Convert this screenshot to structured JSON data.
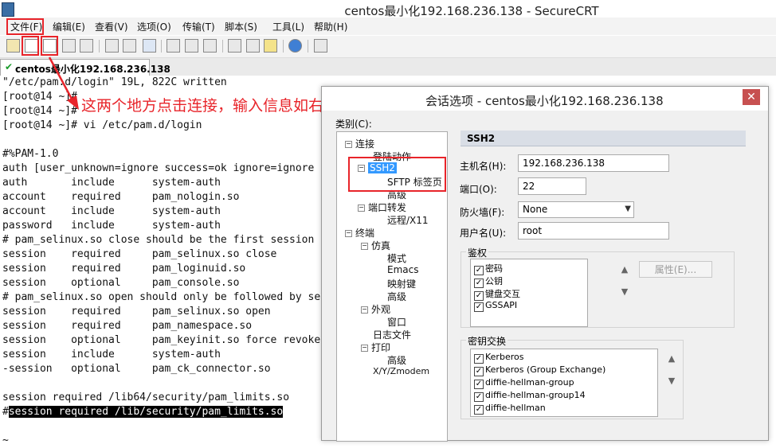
{
  "window": {
    "title": "centos最小化192.168.236.138 - SecureCRT"
  },
  "menu": [
    "文件(F)",
    "编辑(E)",
    "查看(V)",
    "选项(O)",
    "传输(T)",
    "脚本(S)",
    "工具(L)",
    "帮助(H)"
  ],
  "tab": {
    "label": "centos最小化192.168.236.138"
  },
  "terminal": {
    "lines": [
      "\"/etc/pam.d/login\" 19L, 822C written",
      "[root@14 ~]#",
      "[root@14 ~]#",
      "[root@14 ~]# vi /etc/pam.d/login",
      "",
      "#%PAM-1.0",
      "auth [user_unknown=ignore success=ok ignore=ignore",
      "auth       include      system-auth",
      "account    required     pam_nologin.so",
      "account    include      system-auth",
      "password   include      system-auth",
      "# pam_selinux.so close should be the first session",
      "session    required     pam_selinux.so close",
      "session    required     pam_loginuid.so",
      "session    optional     pam_console.so",
      "# pam_selinux.so open should only be followed by se",
      "session    required     pam_selinux.so open",
      "session    required     pam_namespace.so",
      "session    optional     pam_keyinit.so force revoke",
      "session    include      system-auth",
      "-session   optional     pam_ck_connector.so",
      "",
      "session required /lib64/security/pam_limits.so",
      "",
      "~"
    ],
    "highlight_prefix": "#",
    "highlight_text": "session required /lib/security/pam_limits.so"
  },
  "annotation": {
    "text": "这两个地方点击连接，输入信息如右图",
    "color": "#e8242a"
  },
  "dialog": {
    "title": "会话选项 - centos最小化192.168.236.138",
    "close_glyph": "✕",
    "category_label": "类别(C):",
    "tree": {
      "connection": "连接",
      "logon_actions": "登陆动作",
      "ssh2": "SSH2",
      "sftp_tab": "SFTP 标签页",
      "advanced": "高级",
      "port_forwarding": "端口转发",
      "remote_x11": "远程/X11",
      "terminal": "终端",
      "emulation": "仿真",
      "modes": "模式",
      "emacs": "Emacs",
      "mapped_keys": "映射键",
      "emu_advanced": "高级",
      "appearance": "外观",
      "window": "窗口",
      "log_file": "日志文件",
      "printing": "打印",
      "print_advanced": "高级",
      "xyzmodem": "X/Y/Zmodem"
    },
    "section_title": "SSH2",
    "hostname_label": "主机名(H):",
    "hostname_value": "192.168.236.138",
    "port_label": "端口(O):",
    "port_value": "22",
    "firewall_label": "防火墙(F):",
    "firewall_value": "None",
    "username_label": "用户名(U):",
    "username_value": "root",
    "auth_group": "鉴权",
    "auth_methods": [
      "密码",
      "公钥",
      "键盘交互",
      "GSSAPI"
    ],
    "properties_button": "属性(E)...",
    "kex_group": "密钥交换",
    "kex_methods": [
      "Kerberos",
      "Kerberos (Group Exchange)",
      "diffie-hellman-group",
      "diffie-hellman-group14",
      "diffie-hellman"
    ]
  }
}
